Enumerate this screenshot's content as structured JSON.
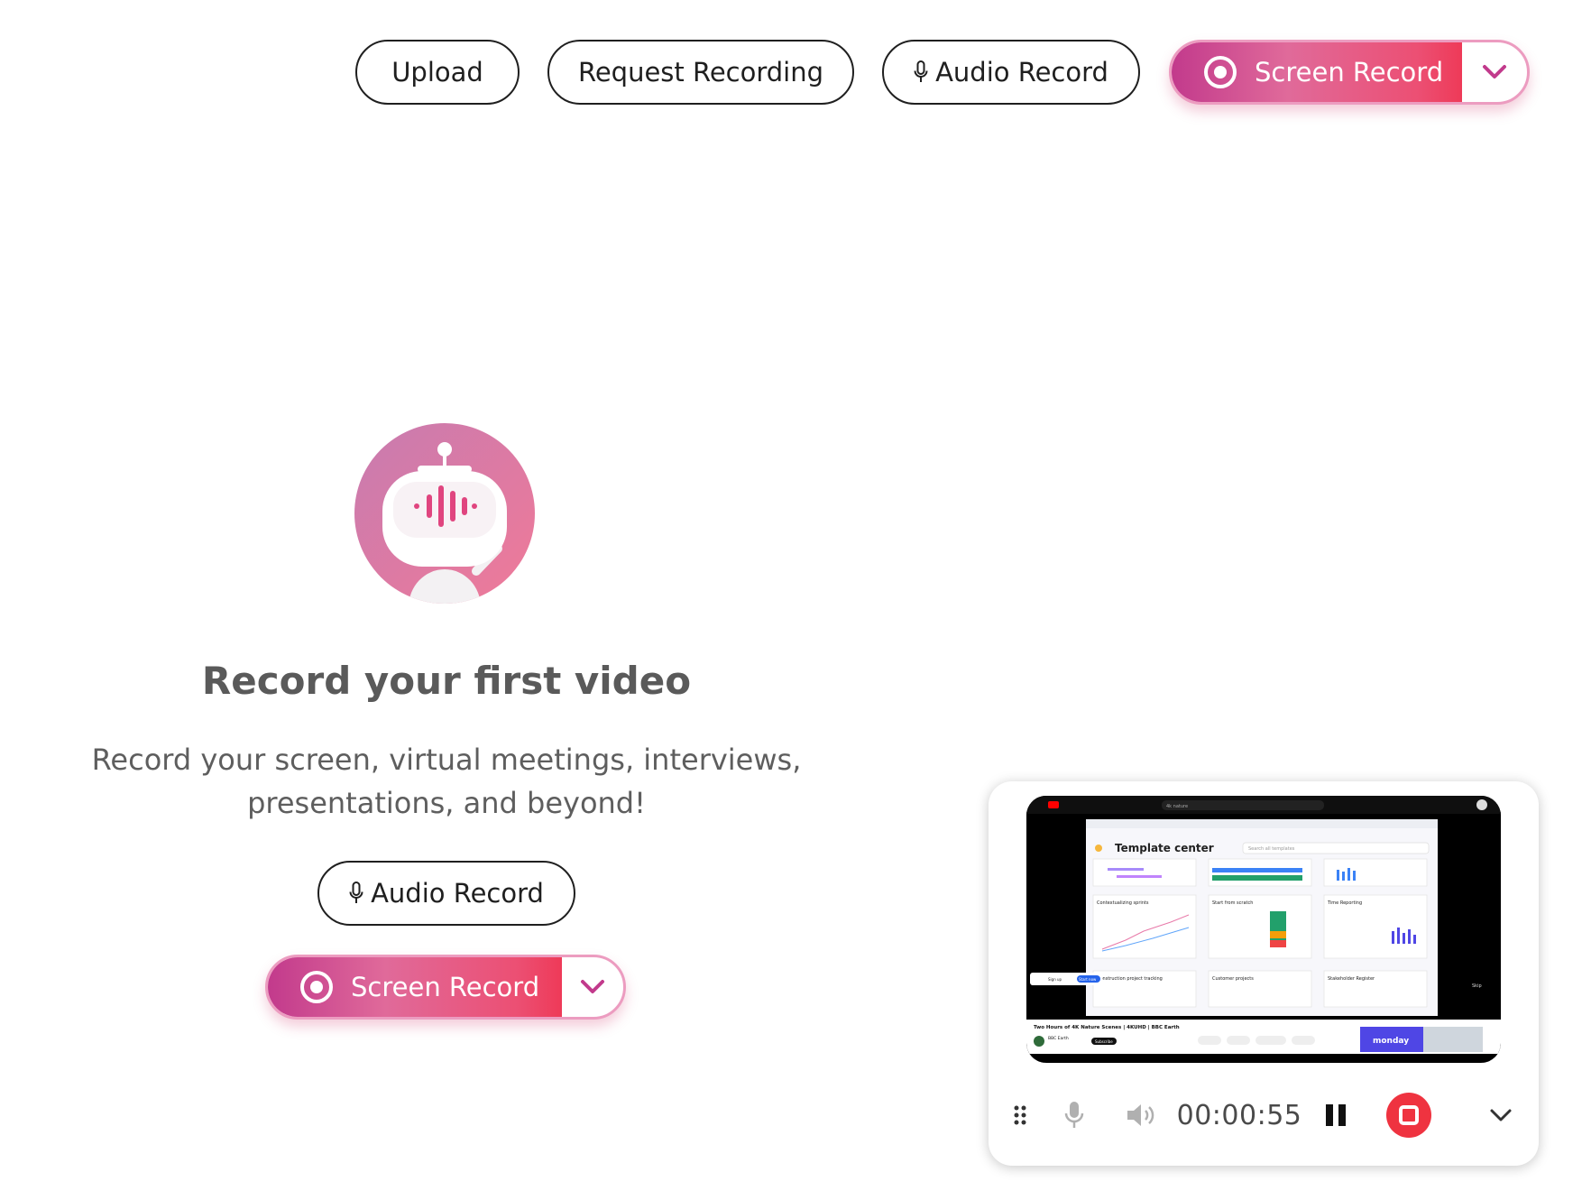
{
  "toolbar": {
    "upload_label": "Upload",
    "request_label": "Request Recording",
    "audio_label": "Audio Record",
    "screen_label": "Screen Record"
  },
  "empty_state": {
    "title": "Record your first video",
    "subtitle": "Record your screen, virtual meetings, interviews, presentations, and beyond!",
    "audio_label": "Audio Record",
    "screen_label": "Screen Record"
  },
  "recorder": {
    "timer": "00:00:55",
    "preview": {
      "youtube_search": "4k nature",
      "page_title": "Template center",
      "search_placeholder": "Search all templates",
      "cards": [
        "Contextualizing sprints",
        "Start from scratch",
        "Time Reporting",
        "Construction project tracking",
        "Customer projects",
        "Stakeholder Register"
      ],
      "video_title": "Two Hours of 4K Nature Scenes | 4KUHD | BBC Earth",
      "channel": "BBC Earth",
      "subscribe": "Subscribe",
      "ad_brand": "monday",
      "sign_up": "Sign up",
      "start_now": "Start now",
      "skip": "Skip"
    }
  },
  "colors": {
    "brand_start": "#c23a8c",
    "brand_end": "#ee3a58",
    "stop_red": "#ef3340"
  }
}
